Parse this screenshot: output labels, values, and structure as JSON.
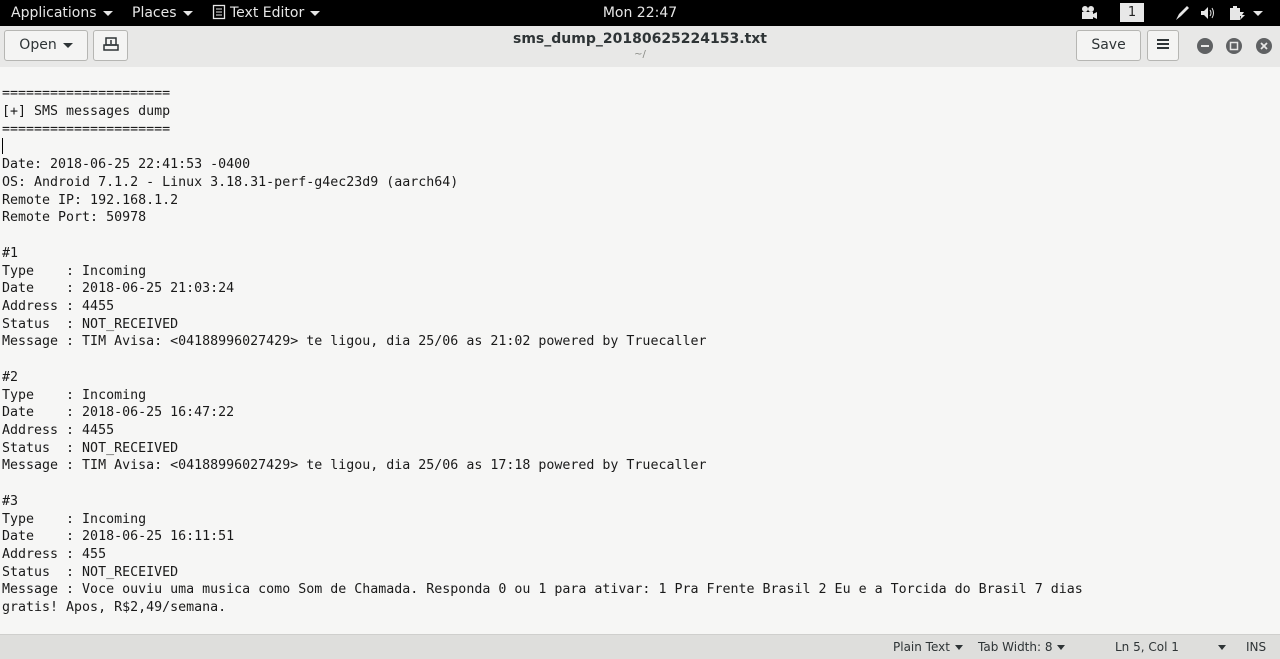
{
  "topbar": {
    "applications": "Applications",
    "places": "Places",
    "app_menu": "Text Editor",
    "clock": "Mon 22:47",
    "workspace": "1"
  },
  "header": {
    "open_label": "Open",
    "title": "sms_dump_20180625224153.txt",
    "subtitle": "~/",
    "save_label": "Save"
  },
  "document": {
    "lines": [
      "=====================",
      "[+] SMS messages dump",
      "=====================",
      "",
      "Date: 2018-06-25 22:41:53 -0400",
      "OS: Android 7.1.2 - Linux 3.18.31-perf-g4ec23d9 (aarch64)",
      "Remote IP: 192.168.1.2",
      "Remote Port: 50978",
      "",
      "#1",
      "Type    : Incoming",
      "Date    : 2018-06-25 21:03:24",
      "Address : 4455",
      "Status  : NOT_RECEIVED",
      "Message : TIM Avisa: <04188996027429> te ligou, dia 25/06 as 21:02 powered by Truecaller",
      "",
      "#2",
      "Type    : Incoming",
      "Date    : 2018-06-25 16:47:22",
      "Address : 4455",
      "Status  : NOT_RECEIVED",
      "Message : TIM Avisa: <04188996027429> te ligou, dia 25/06 as 17:18 powered by Truecaller",
      "",
      "#3",
      "Type    : Incoming",
      "Date    : 2018-06-25 16:11:51",
      "Address : 455",
      "Status  : NOT_RECEIVED",
      "Message : Voce ouviu uma musica como Som de Chamada. Responda 0 ou 1 para ativar: 1 Pra Frente Brasil 2 Eu e a Torcida do Brasil 7 dias",
      "gratis! Apos, R$2,49/semana."
    ]
  },
  "statusbar": {
    "language": "Plain Text",
    "tab_width": "Tab Width: 8",
    "position": "Ln 5, Col 1",
    "mode": "INS"
  }
}
